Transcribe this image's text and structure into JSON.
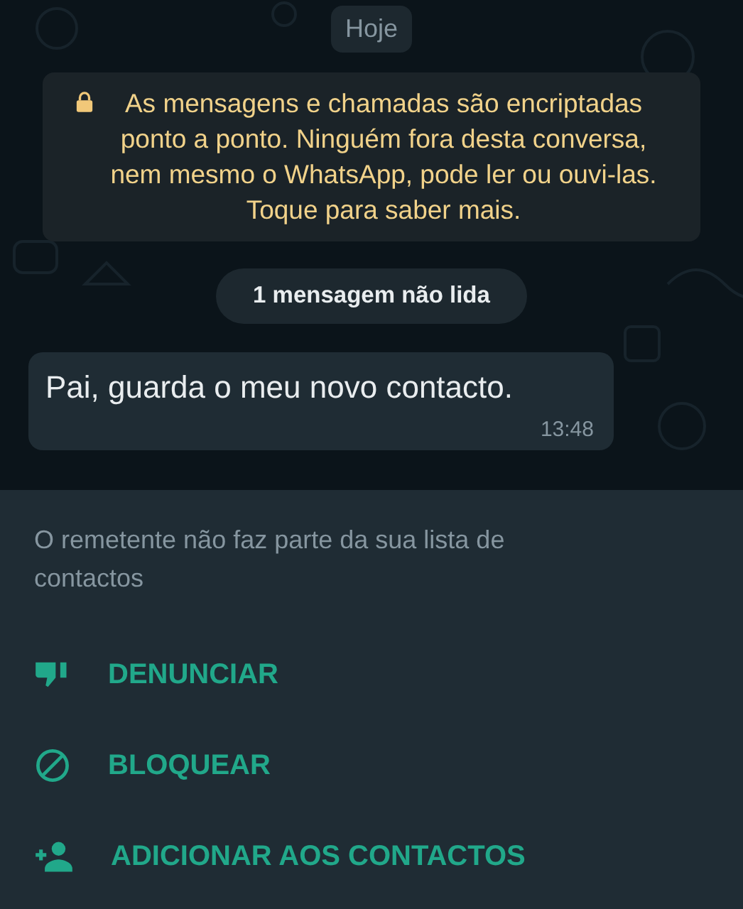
{
  "date_chip": "Hoje",
  "encryption_notice": "As mensagens e chamadas são encriptadas ponto a ponto. Ninguém fora desta conversa, nem mesmo o WhatsApp, pode ler ou ouvi-las. Toque para saber mais.",
  "unread_banner": "1 mensagem não lida",
  "messages": [
    {
      "text": "Pai, guarda o meu novo contacto.",
      "time": "13:48"
    }
  ],
  "unknown_sender_notice": "O remetente não faz parte da sua lista de contactos",
  "actions": [
    {
      "kind": "report",
      "label": "DENUNCIAR"
    },
    {
      "kind": "block",
      "label": "BLOQUEAR"
    },
    {
      "kind": "add-contact",
      "label": "ADICIONAR AOS CONTACTOS"
    }
  ]
}
